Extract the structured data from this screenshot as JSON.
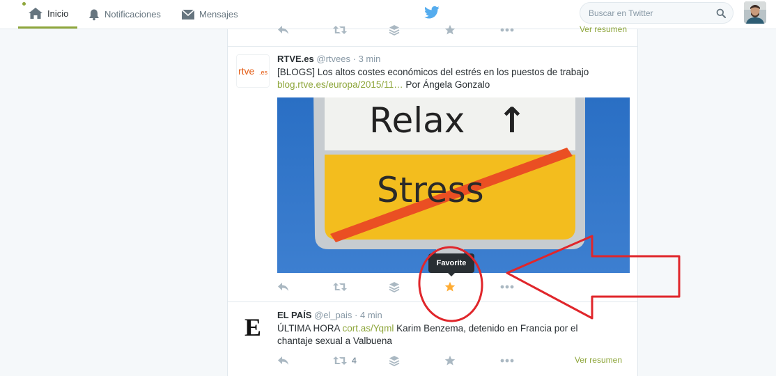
{
  "nav": {
    "home_label": "Inicio",
    "notifications_label": "Notificaciones",
    "messages_label": "Mensajes"
  },
  "search": {
    "placeholder": "Buscar en Twitter"
  },
  "colors": {
    "accent": "#8ea63b",
    "favorite": "#ffac33",
    "annotation": "#e0262b",
    "text": "#292f33",
    "muted": "#8899a6"
  },
  "previous_tweet": {
    "summary_label": "Ver resumen"
  },
  "tweets": [
    {
      "avatar_text": "rtve.es",
      "name": "RTVE.es",
      "handle": "@rtvees",
      "separator": "·",
      "time": "3 min",
      "text_line1": "[BLOGS] Los altos costes económicos del estrés en los puestos de trabajo",
      "link": "blog.rtve.es/europa/2015/11…",
      "text_after_link": " Por Ángela Gonzalo",
      "media": {
        "sign_top": "Relax",
        "sign_bottom": "Stress",
        "arrow": "↑"
      },
      "tooltip": "Favorite",
      "favorited": true
    },
    {
      "avatar_text": "E",
      "name": "EL PAÍS",
      "handle": "@el_pais",
      "separator": "·",
      "time": "4 min",
      "text_prefix": "ÚLTIMA HORA ",
      "link": "cort.as/Yqml",
      "text_suffix": " Karim Benzema, detenido en Francia por el chantaje sexual a Valbuena",
      "retweet_count": "4",
      "summary_label": "Ver resumen"
    }
  ]
}
